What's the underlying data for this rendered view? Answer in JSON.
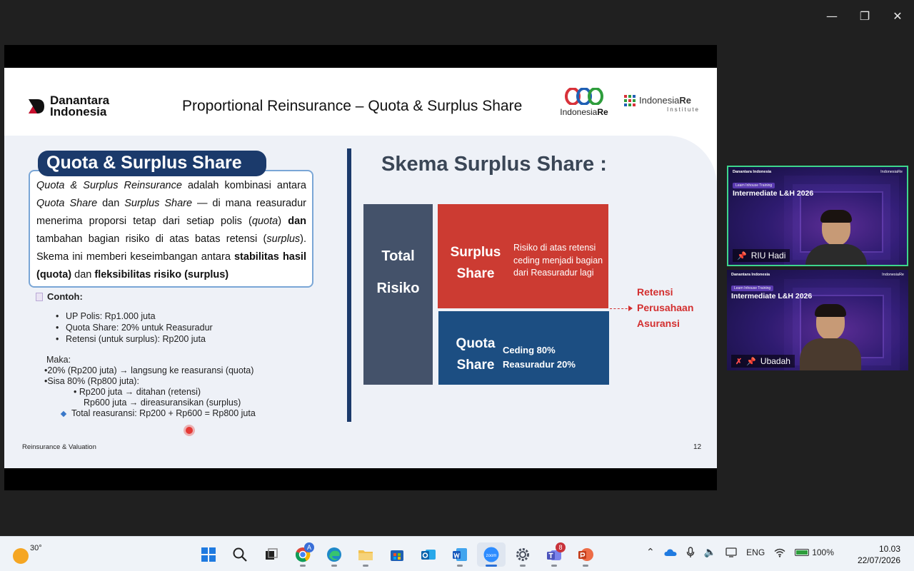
{
  "window": {
    "minimize": "—",
    "maximize": "❐",
    "close": "✕"
  },
  "slide": {
    "brand_left": "Danantara Indonesia",
    "title": "Proportional Reinsurance – Quota & Surplus Share",
    "brand_mid": {
      "part1": "Indonesia",
      "part2": "Re"
    },
    "brand_right": {
      "name1": "Indonesia",
      "name2": "Re",
      "sub": "Institute"
    },
    "heading": "Quota & Surplus Share",
    "intro": {
      "s1": "Quota & Surplus Reinsurance",
      "s2": " adalah kombinasi antara ",
      "s3": "Quota Share",
      "s4": " dan ",
      "s5": "Surplus Share",
      "s6": " — di mana reasuradur menerima proporsi tetap dari setiap polis (",
      "s7": "quota",
      "s8": ") ",
      "s9": "dan",
      "s10": " tambahan bagian risiko di atas batas retensi (",
      "s11": "surplus",
      "s12": ").",
      "s13": " Skema ini memberi keseimbangan antara ",
      "s14": "stabilitas hasil (quota)",
      "s15": " dan ",
      "s16": "fleksibilitas risiko (surplus)"
    },
    "example_title": "Contoh:",
    "example_items": [
      "UP Polis: Rp1.000 juta",
      "Quota Share: 20% untuk Reasuradur",
      "Retensi (untuk surplus): Rp200 juta"
    ],
    "maka": "Maka:",
    "maka_1": "•20% (Rp200 juta) → langsung ke reasuransi (quota)",
    "maka_2": "•Sisa 80% (Rp800 juta):",
    "maka_2a": "•   Rp200 juta → ditahan (retensi)",
    "maka_2b": "Rp600 juta → direasuransikan (surplus)",
    "total": "Total reasuransi: Rp200 + Rp600 = Rp800 juta",
    "footer_left": "Reinsurance & Valuation",
    "page_number": "12",
    "diagram_title": "Skema Surplus Share :",
    "total_box": {
      "line1": "Total",
      "line2": "Risiko"
    },
    "surplus_box": {
      "line1": "Surplus",
      "line2": "Share",
      "desc": "Risiko di atas retensi ceding menjadi bagian dari Reasuradur lagi"
    },
    "quota_box": {
      "line1": "Quota",
      "line2": "Share",
      "desc1": "Ceding 80%",
      "desc2": "Reasuradur 20%"
    },
    "retensi": {
      "line1": "Retensi",
      "line2": "Perusahaan",
      "line3": "Asuransi"
    }
  },
  "tiles": [
    {
      "name": "RIU Hadi",
      "event": "Intermediate L&H 2026",
      "badge": "Learn Inhouse Training",
      "logo_left": "Danantara Indonesia",
      "logo_right": "IndonesiaRe"
    },
    {
      "name": "Ubadah",
      "event": "Intermediate L&H 2026",
      "badge": "Learn Inhouse Training",
      "logo_left": "Danantara Indonesia",
      "logo_right": "IndonesiaRe"
    }
  ],
  "taskbar": {
    "weather_temp": "30°",
    "chrome_badge": "A",
    "teams_badge": "8",
    "lang": "ENG",
    "battery": "100%",
    "time": "10.03",
    "date": "22/07/2026"
  },
  "colors": {
    "navy": "#1b3a6b",
    "red": "#cc3b32",
    "blue": "#1c4e82",
    "slate": "#44526a",
    "accent_red": "#d32f2f"
  }
}
